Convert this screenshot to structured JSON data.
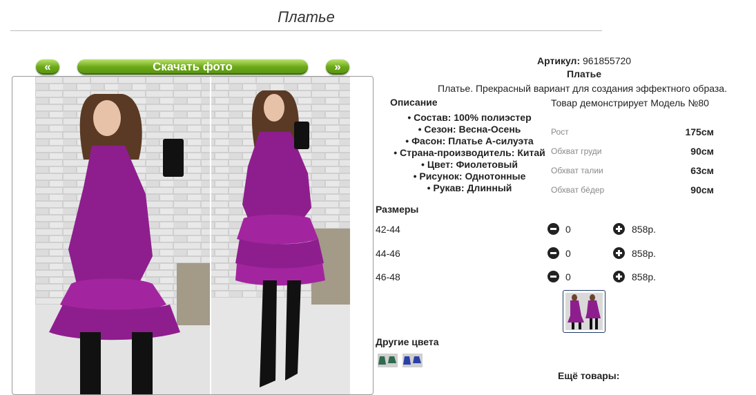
{
  "page": {
    "title": "Платье"
  },
  "gallery": {
    "prev_label": "«",
    "download_label": "Скачать фото",
    "next_label": "»"
  },
  "product": {
    "article_label": "Артикул:",
    "article_value": "961855720",
    "name": "Платье",
    "description": "Платье. Прекрасный вариант для создания эффектного образа.",
    "description_heading": "Описание",
    "properties": [
      "Состав: 100% полиэстер",
      "Сезон: Весна-Осень",
      "Фасон: Платье А-силуэта",
      "Страна-производитель: Китай",
      "Цвет: Фиолетовый",
      "Рисунок: Однотонные",
      "Рукав: Длинный"
    ]
  },
  "model": {
    "title": "Товар демонстрирует Модель №80",
    "rows": [
      {
        "label": "Рост",
        "value": "175см"
      },
      {
        "label": "Обхват груди",
        "value": "90см"
      },
      {
        "label": "Обхват талии",
        "value": "63см"
      },
      {
        "label": "Обхват бёдер",
        "value": "90см"
      }
    ]
  },
  "sizes": {
    "heading": "Размеры",
    "rows": [
      {
        "size": "42-44",
        "qty": "0",
        "price": "858р."
      },
      {
        "size": "44-46",
        "qty": "0",
        "price": "858р."
      },
      {
        "size": "46-48",
        "qty": "0",
        "price": "858р."
      }
    ]
  },
  "other_colors": {
    "heading": "Другие цвета"
  },
  "more": {
    "heading": "Ещё товары:"
  },
  "colors": {
    "button_green": "#6ca819",
    "dress_purple": "#8e1e8e",
    "dress_green": "#2e6b4f",
    "dress_blue": "#2b3fa8"
  }
}
